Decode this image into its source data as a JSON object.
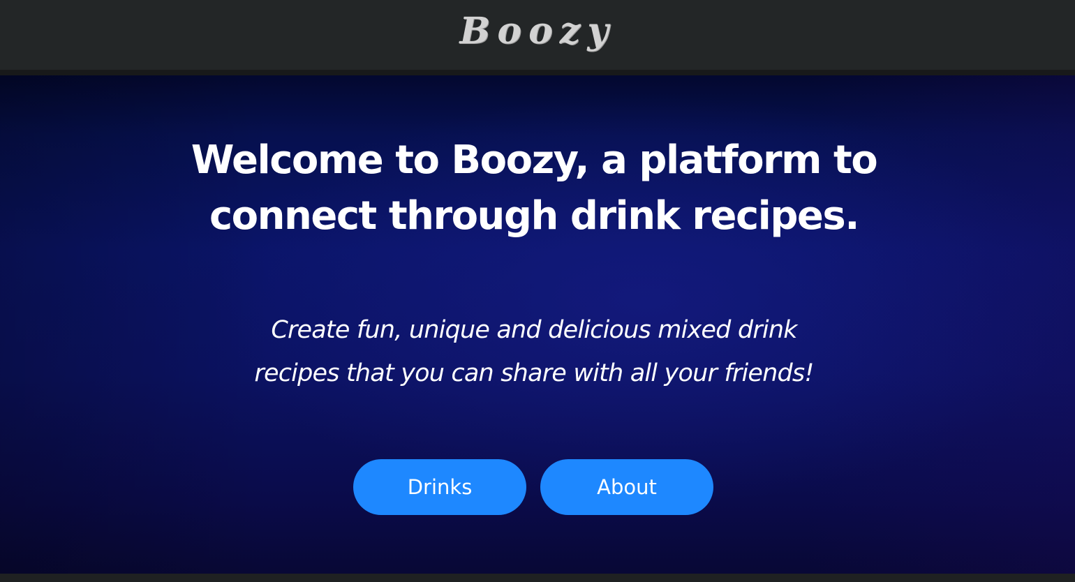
{
  "navbar": {
    "brand": "Boozy"
  },
  "hero": {
    "headline": "Welcome to Boozy, a platform to connect through drink recipes.",
    "subtitle": "Create fun, unique and delicious mixed drink recipes that you can share with all your friends!",
    "buttons": [
      {
        "label": "Drinks"
      },
      {
        "label": "About"
      }
    ]
  },
  "colors": {
    "navbar_bg": "#232627",
    "brand_text": "#d2d2d2",
    "hero_bg": "#0a1468",
    "button_bg": "#1e88ff",
    "text": "#ffffff"
  }
}
